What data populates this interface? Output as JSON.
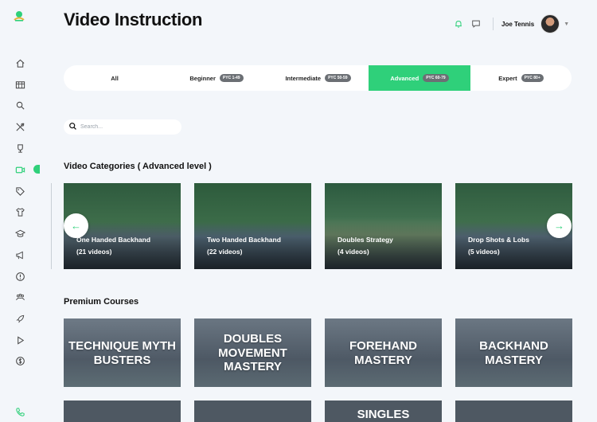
{
  "header": {
    "title": "Video Instruction",
    "user_name": "Joe Tennis"
  },
  "sidebar": {
    "items": [
      "home-icon",
      "calendar-icon",
      "search-icon",
      "racket-icon",
      "trophy-icon",
      "video-icon",
      "tag-icon",
      "shirt-icon",
      "graduation-cap-icon",
      "megaphone-icon",
      "help-icon",
      "community-icon",
      "rocket-icon",
      "play-icon",
      "dollar-icon"
    ],
    "active": "video-icon",
    "footer": "phone-icon"
  },
  "tabs": [
    {
      "label": "All",
      "badge": ""
    },
    {
      "label": "Beginner",
      "badge": "PYC 1-49"
    },
    {
      "label": "Intermediate",
      "badge": "PYC 50-59"
    },
    {
      "label": "Advanced",
      "badge": "PYC 60-79"
    },
    {
      "label": "Expert",
      "badge": "PYC 80+"
    }
  ],
  "active_tab": "Advanced",
  "search": {
    "placeholder": "Search..."
  },
  "categories": {
    "title": "Video Categories ( Advanced level )",
    "items": [
      {
        "name": "One Handed Backhand",
        "count": "(21 videos)"
      },
      {
        "name": "Two Handed Backhand",
        "count": "(22 videos)"
      },
      {
        "name": "Doubles Strategy",
        "count": "(4 videos)"
      },
      {
        "name": "Drop Shots & Lobs",
        "count": "(5 videos)"
      }
    ]
  },
  "premium": {
    "title": "Premium Courses",
    "courses": [
      {
        "line1": "TECHNIQUE MYTH",
        "line2": "BUSTERS",
        "line3": ""
      },
      {
        "line1": "DOUBLES",
        "line2": "MOVEMENT",
        "line3": "MASTERY"
      },
      {
        "line1": "FOREHAND",
        "line2": "MASTERY",
        "line3": ""
      },
      {
        "line1": "BACKHAND",
        "line2": "MASTERY",
        "line3": ""
      }
    ],
    "next_row_visible_title": "SINGLES"
  },
  "colors": {
    "accent": "#2fd07a",
    "badge": "#6b6f74",
    "background": "#f3f6fa"
  }
}
